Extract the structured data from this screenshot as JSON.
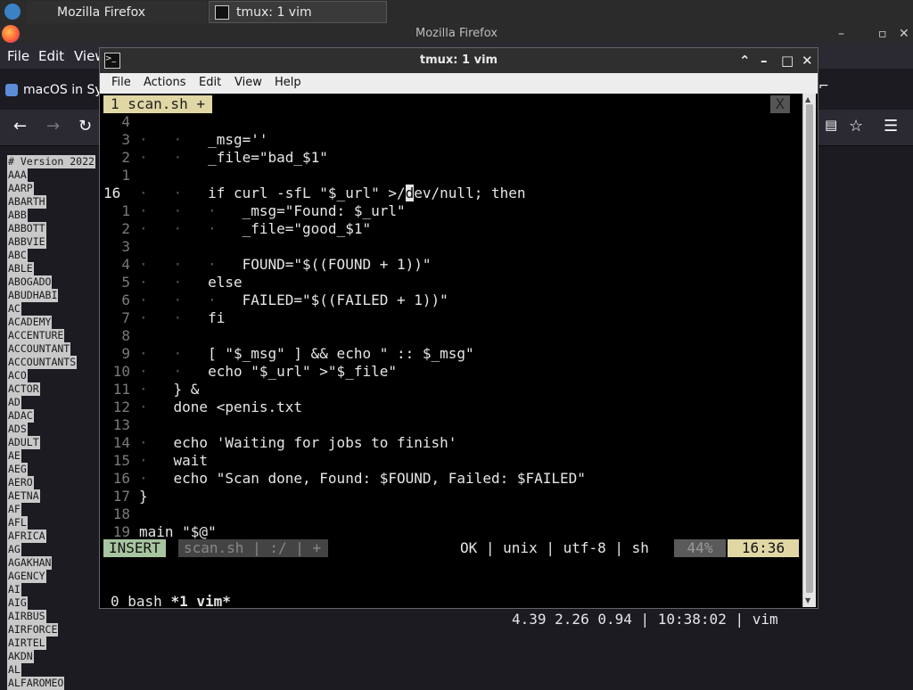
{
  "taskbar": {
    "tasks": [
      {
        "label": "Mozilla Firefox"
      },
      {
        "label": "tmux: 1 vim"
      }
    ]
  },
  "firefox": {
    "title": "Mozilla Firefox",
    "menu": [
      "File",
      "Edit",
      "View"
    ],
    "tab_label": "macOS in Sy",
    "domain_list": [
      "# Version 2022",
      "AAA",
      "AARP",
      "ABARTH",
      "ABB",
      "ABBOTT",
      "ABBVIE",
      "ABC",
      "ABLE",
      "ABOGADO",
      "ABUDHABI",
      "AC",
      "ACADEMY",
      "ACCENTURE",
      "ACCOUNTANT",
      "ACCOUNTANTS",
      "ACO",
      "ACTOR",
      "AD",
      "ADAC",
      "ADS",
      "ADULT",
      "AE",
      "AEG",
      "AERO",
      "AETNA",
      "AF",
      "AFL",
      "AFRICA",
      "AG",
      "AGAKHAN",
      "AGENCY",
      "AI",
      "AIG",
      "AIRBUS",
      "AIRFORCE",
      "AIRTEL",
      "AKDN",
      "AL",
      "ALFAROMEO"
    ]
  },
  "terminal": {
    "title": "tmux: 1 vim",
    "menu": [
      "File",
      "Actions",
      "Edit",
      "View",
      "Help"
    ],
    "tab_label": "1 scan.sh +",
    "tab_close": "X",
    "lines": [
      {
        "n": "4",
        "code": ""
      },
      {
        "n": "3",
        "code": "_msg=''"
      },
      {
        "n": "2",
        "code": "_file=\"bad_$1\""
      },
      {
        "n": "1",
        "code": ""
      },
      {
        "n": "16",
        "code": "if curl -sfL \"$_url\" >/dev/null; then"
      },
      {
        "n": "1",
        "code": "_msg=\"Found: $_url\""
      },
      {
        "n": "2",
        "code": "_file=\"good_$1\""
      },
      {
        "n": "3",
        "code": ""
      },
      {
        "n": "4",
        "code": "FOUND=\"$((FOUND + 1))\""
      },
      {
        "n": "5",
        "code": "else"
      },
      {
        "n": "6",
        "code": "FAILED=\"$((FAILED + 1))\""
      },
      {
        "n": "7",
        "code": "fi"
      },
      {
        "n": "8",
        "code": ""
      },
      {
        "n": "9",
        "code": "[ \"$_msg\" ] && echo \" :: $_msg\""
      },
      {
        "n": "10",
        "code": "echo \"$_url\" >\"$_file\""
      },
      {
        "n": "11",
        "code": "} &"
      },
      {
        "n": "12",
        "code": "done <penis.txt"
      },
      {
        "n": "13",
        "code": ""
      },
      {
        "n": "14",
        "code": "echo 'Waiting for jobs to finish'"
      },
      {
        "n": "15",
        "code": "wait"
      },
      {
        "n": "16",
        "code": "echo \"Scan done, Found: $FOUND, Failed: $FAILED\""
      },
      {
        "n": "17",
        "code": "}"
      },
      {
        "n": "18",
        "code": ""
      },
      {
        "n": "19",
        "code": "main \"$@\""
      }
    ],
    "status": {
      "mode": "INSERT",
      "file": "scan.sh | :/ | +",
      "info": "OK | unix | utf-8 | sh",
      "percent": "44%",
      "position": "16:36"
    },
    "tmux": {
      "windows_prefix": "0 bash ",
      "active_window": "*1 vim*",
      "right": "4.39 2.26 0.94 | 10:38:02 | vim"
    }
  }
}
